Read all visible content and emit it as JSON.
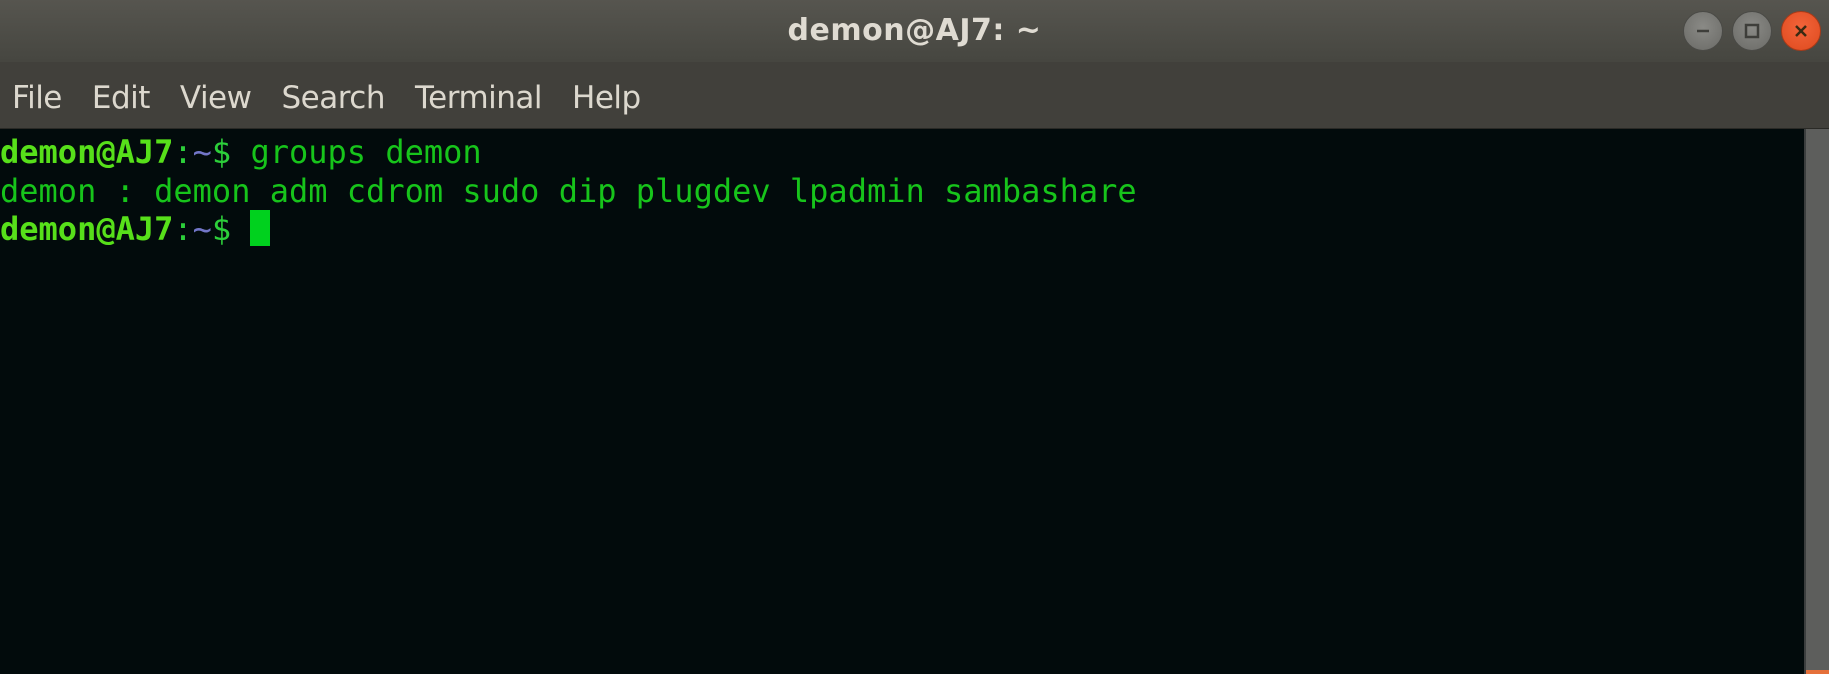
{
  "window": {
    "title": "demon@AJ7: ~",
    "controls": [
      {
        "name": "minimize",
        "icon": "minimize-icon"
      },
      {
        "name": "maximize",
        "icon": "maximize-icon"
      },
      {
        "name": "close",
        "icon": "close-icon"
      }
    ]
  },
  "menubar": {
    "items": [
      {
        "label": "File"
      },
      {
        "label": "Edit"
      },
      {
        "label": "View"
      },
      {
        "label": "Search"
      },
      {
        "label": "Terminal"
      },
      {
        "label": "Help"
      }
    ]
  },
  "terminal": {
    "prompt": {
      "user_host": "demon@AJ7",
      "colon": ":",
      "path": "~",
      "symbol": "$"
    },
    "lines": [
      {
        "type": "command",
        "command": " groups demon"
      },
      {
        "type": "output",
        "text": "demon : demon adm cdrom sudo dip plugdev lpadmin sambashare"
      },
      {
        "type": "prompt",
        "command": " "
      }
    ]
  },
  "colors": {
    "prompt_user": "#57e01a",
    "prompt_path": "#7276c8",
    "text": "#17c41b",
    "cursor": "#00d11e",
    "background": "#020b0c",
    "close_button": "#ea5427"
  }
}
